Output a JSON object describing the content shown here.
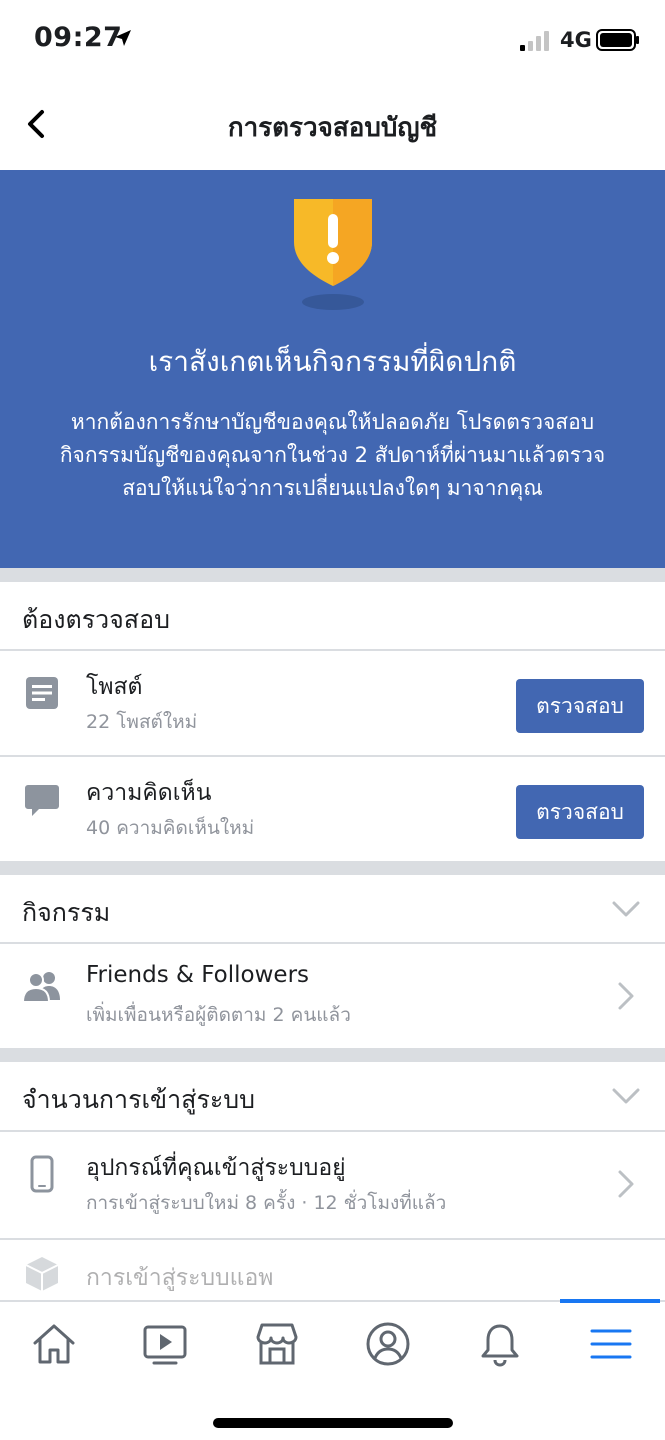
{
  "status": {
    "time": "09:27",
    "network": "4G"
  },
  "nav": {
    "title": "การตรวจสอบบัญชี"
  },
  "hero": {
    "title": "เราสังเกตเห็นกิจกรรมที่ผิดปกติ",
    "description": "หากต้องการรักษาบัญชีของคุณให้ปลอดภัย โปรดตรวจสอบกิจกรรมบัญชีของคุณจากในช่วง 2 สัปดาห์ที่ผ่านมาแล้วตรวจสอบให้แน่ใจว่าการเปลี่ยนแปลงใดๆ มาจากคุณ"
  },
  "to_review": {
    "title": "ต้องตรวจสอบ",
    "items": [
      {
        "icon": "post-icon",
        "title": "โพสต์",
        "subtitle": "22 โพสต์ใหม่",
        "button": "ตรวจสอบ"
      },
      {
        "icon": "comment-icon",
        "title": "ความคิดเห็น",
        "subtitle": "40 ความคิดเห็นใหม่",
        "button": "ตรวจสอบ"
      }
    ]
  },
  "activity": {
    "title": "กิจกรรม",
    "items": [
      {
        "icon": "friends-icon",
        "title": "Friends & Followers",
        "subtitle": "เพิ่มเพื่อนหรือผู้ติดตาม 2 คนแล้ว"
      }
    ]
  },
  "logins": {
    "title": "จำนวนการเข้าสู่ระบบ",
    "items": [
      {
        "icon": "phone-icon",
        "title": "อุปกรณ์ที่คุณเข้าสู่ระบบอยู่",
        "subtitle": "การเข้าสู่ระบบใหม่ 8 ครั้ง · 12 ชั่วโมงที่แล้ว"
      },
      {
        "icon": "app-box-icon",
        "title": "การเข้าสู่ระบบแอพ"
      }
    ]
  },
  "tabbar": [
    "home-icon",
    "watch-icon",
    "marketplace-icon",
    "profile-icon",
    "notifications-icon",
    "menu-icon"
  ],
  "colors": {
    "brand": "#4267b2",
    "active": "#1877f2",
    "shield": "#f7b928"
  }
}
